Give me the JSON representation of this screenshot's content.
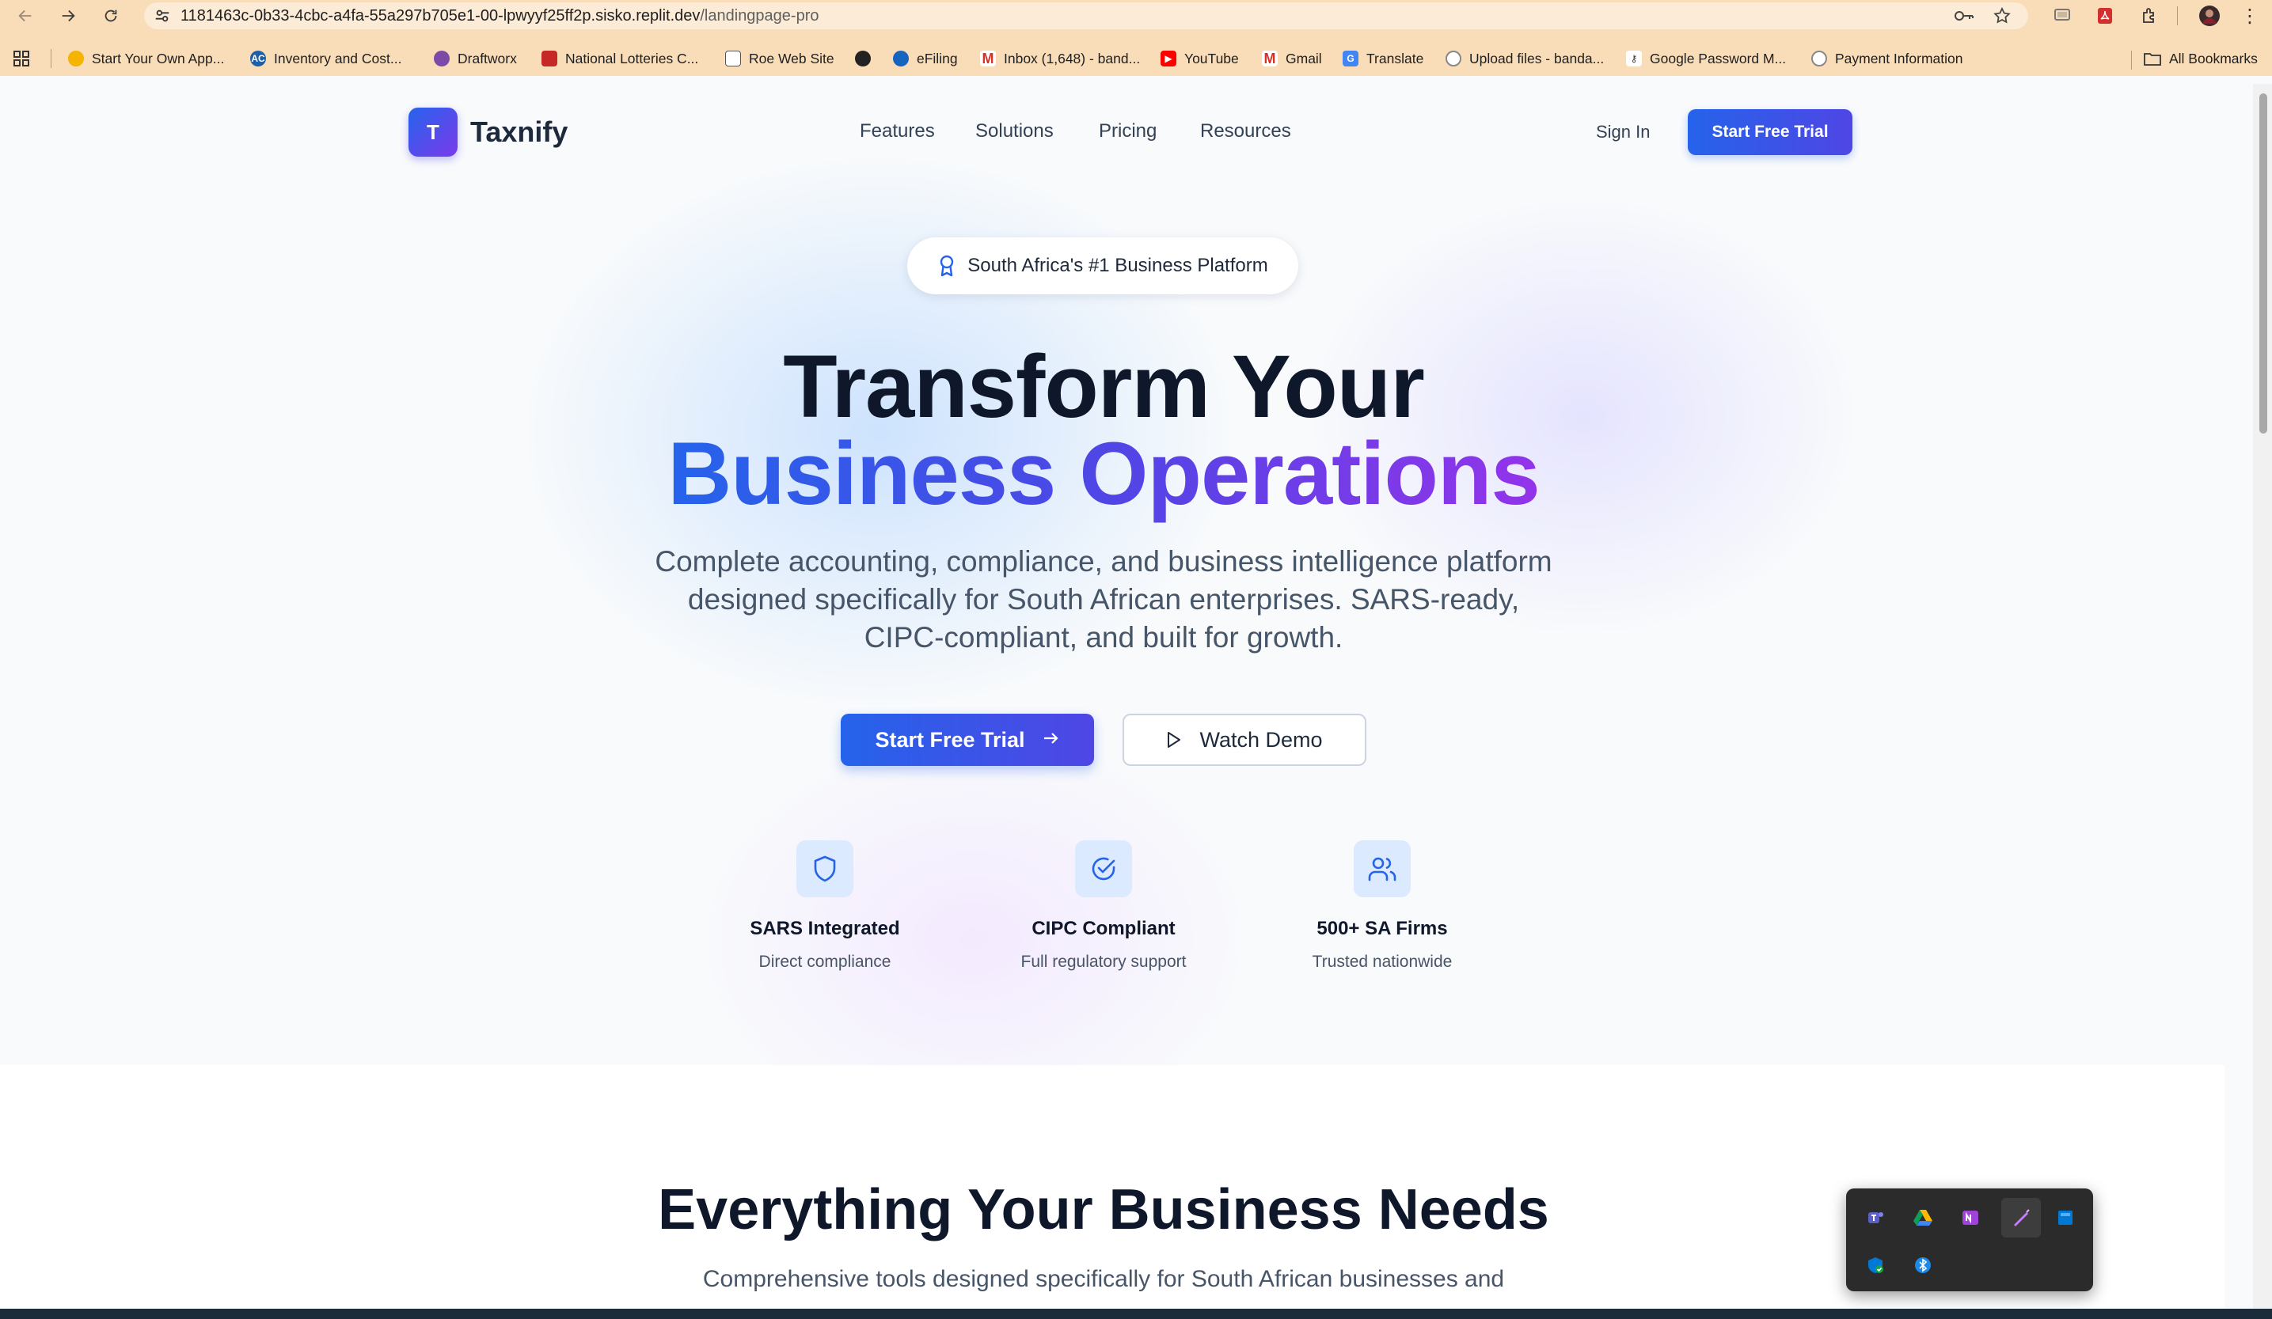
{
  "browser": {
    "url_host": "1181463c-0b33-4cbc-a4fa-55a297b705e1-00-lpwyyf25ff2p.sisko.replit.dev",
    "url_path": "/landingpage-pro",
    "bookmarks": [
      "Start Your Own App...",
      "Inventory and Cost...",
      "Draftworx",
      "National Lotteries C...",
      "Roe Web Site",
      "",
      "eFiling",
      "Inbox (1,648) - band...",
      "YouTube",
      "Gmail",
      "Translate",
      "Upload files - banda...",
      "Google Password M...",
      "Payment Information"
    ],
    "all_bookmarks": "All Bookmarks"
  },
  "nav": {
    "logo_letter": "T",
    "brand": "Taxnify",
    "links": [
      "Features",
      "Solutions",
      "Pricing",
      "Resources"
    ],
    "sign_in": "Sign In",
    "cta": "Start Free Trial"
  },
  "hero": {
    "badge": "South Africa's #1 Business Platform",
    "title_line1": "Transform Your",
    "title_line2": "Business Operations",
    "subtitle": "Complete accounting, compliance, and business intelligence platform designed specifically for South African enterprises. SARS-ready, CIPC-compliant, and built for growth.",
    "primary_button": "Start Free Trial",
    "secondary_button": "Watch Demo"
  },
  "features": [
    {
      "icon": "shield-icon",
      "title": "SARS Integrated",
      "desc": "Direct compliance"
    },
    {
      "icon": "check-circle-icon",
      "title": "CIPC Compliant",
      "desc": "Full regulatory support"
    },
    {
      "icon": "users-icon",
      "title": "500+ SA Firms",
      "desc": "Trusted nationwide"
    }
  ],
  "section2": {
    "title": "Everything Your Business Needs",
    "subtitle": "Comprehensive tools designed specifically for South African businesses and"
  },
  "colors": {
    "primary": "#2563eb",
    "indigo": "#4f46e5",
    "purple": "#9333ea",
    "chrome": "#f9dcb8"
  }
}
